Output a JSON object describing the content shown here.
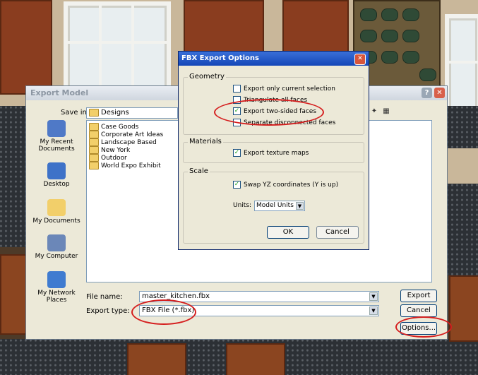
{
  "export_dialog": {
    "title": "Export Model",
    "help_glyph": "?",
    "close_glyph": "✕",
    "save_in_label": "Save in:",
    "save_in_value": "Designs",
    "places": [
      {
        "label": "My Recent Documents",
        "icon": "recent-documents-icon",
        "color": "#4f79c7"
      },
      {
        "label": "Desktop",
        "icon": "desktop-icon",
        "color": "#3e72c8"
      },
      {
        "label": "My Documents",
        "icon": "my-documents-icon",
        "color": "#f2cf6a"
      },
      {
        "label": "My Computer",
        "icon": "my-computer-icon",
        "color": "#6b87b8"
      },
      {
        "label": "My Network Places",
        "icon": "network-places-icon",
        "color": "#3f7bd0"
      }
    ],
    "files": [
      "Case Goods",
      "Corporate Art Ideas",
      "Landscape Based",
      "New York",
      "Outdoor",
      "World Expo Exhibit"
    ],
    "file_name_label": "File name:",
    "file_name_value": "master_kitchen.fbx",
    "export_type_label": "Export type:",
    "export_type_value": "FBX File (*.fbx)",
    "export_button": "Export",
    "cancel_button": "Cancel",
    "options_button": "Options..."
  },
  "fbx_dialog": {
    "title": "FBX Export Options",
    "close_glyph": "✕",
    "geometry_label": "Geometry",
    "geometry_options": [
      {
        "label": "Export only current selection",
        "checked": false
      },
      {
        "label": "Triangulate all faces",
        "checked": false
      },
      {
        "label": "Export two-sided faces",
        "checked": true
      },
      {
        "label": "Separate disconnected faces",
        "checked": false
      }
    ],
    "materials_label": "Materials",
    "materials_option": {
      "label": "Export texture maps",
      "checked": true
    },
    "scale_label": "Scale",
    "scale_option": {
      "label": "Swap YZ coordinates (Y is up)",
      "checked": true
    },
    "units_label": "Units:",
    "units_value": "Model Units",
    "ok_button": "OK",
    "cancel_button": "Cancel"
  },
  "colors": {
    "annotation_red": "#d51e1e",
    "check_green": "#21a121"
  }
}
